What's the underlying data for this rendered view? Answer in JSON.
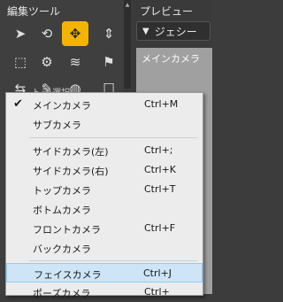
{
  "tools_panel": {
    "title": "編集ツール"
  },
  "preview_panel": {
    "title": "プレビュー",
    "dropdown_value": "ジェシー",
    "viewport_label": "メインカメラ"
  },
  "partial_label": "トラ 選択",
  "menu": {
    "items": [
      {
        "label": "メインカメラ",
        "shortcut": "Ctrl+M",
        "checked": true
      },
      {
        "label": "サブカメラ",
        "shortcut": ""
      },
      {
        "label": "サイドカメラ(左)",
        "shortcut": "Ctrl+;"
      },
      {
        "label": "サイドカメラ(右)",
        "shortcut": "Ctrl+K"
      },
      {
        "label": "トップカメラ",
        "shortcut": "Ctrl+T"
      },
      {
        "label": "ボトムカメラ",
        "shortcut": ""
      },
      {
        "label": "フロントカメラ",
        "shortcut": "Ctrl+F"
      },
      {
        "label": "バックカメラ",
        "shortcut": ""
      },
      {
        "label": "フェイスカメラ",
        "shortcut": "Ctrl+J"
      },
      {
        "label": "ポーズカメラ",
        "shortcut": "Ctrl+"
      }
    ]
  }
}
